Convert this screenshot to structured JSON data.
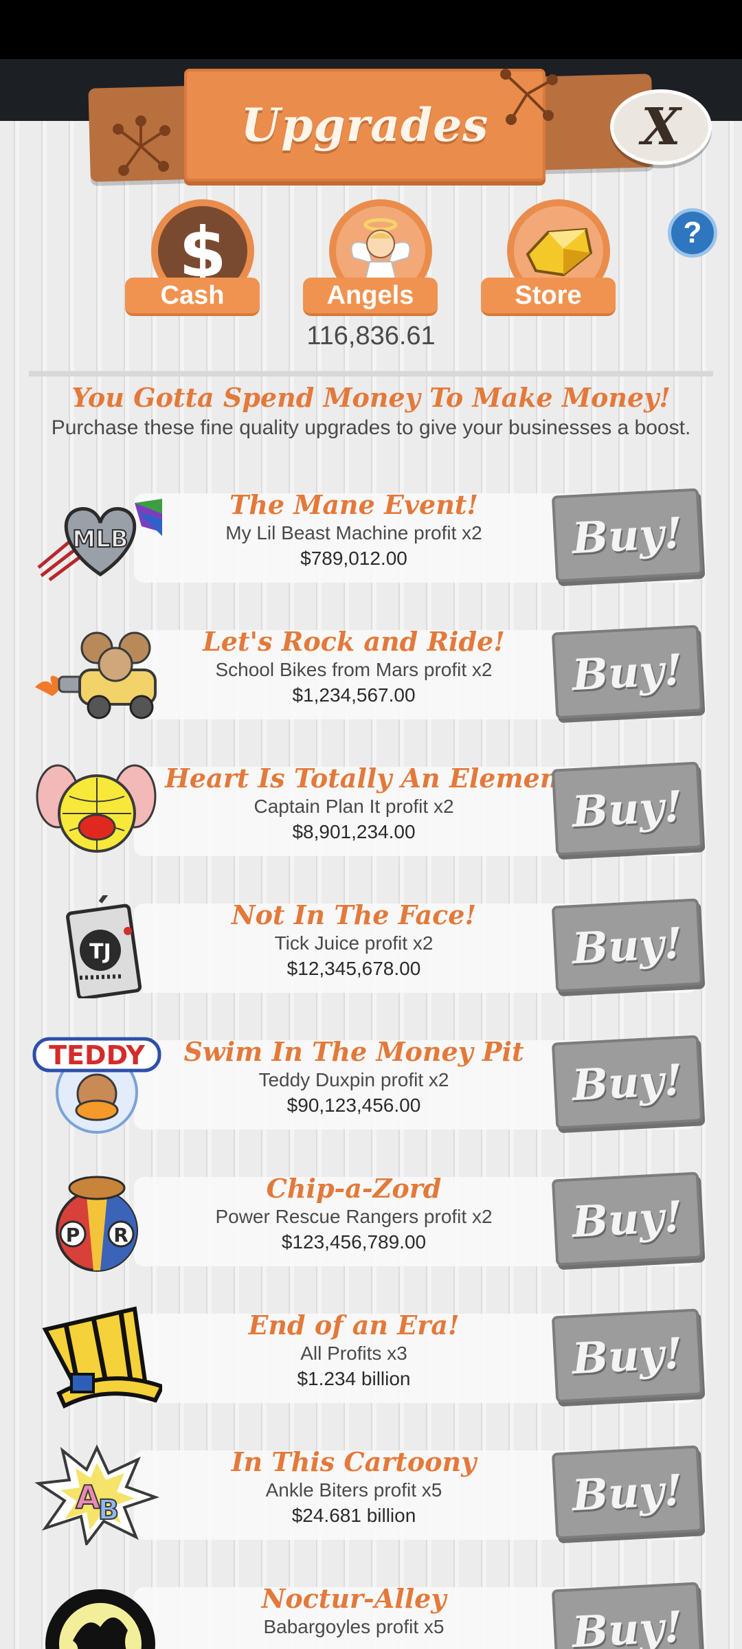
{
  "header": {
    "title": "Upgrades",
    "close_label": "X"
  },
  "tabs": [
    {
      "label": "Cash",
      "icon": "dollar-icon"
    },
    {
      "label": "Angels",
      "icon": "angel-icon"
    },
    {
      "label": "Store",
      "icon": "gold-icon"
    }
  ],
  "help_label": "?",
  "balance": "116,836.61",
  "headline": "You Gotta Spend Money To Make Money!",
  "subline": "Purchase these fine quality upgrades to give your businesses a boost.",
  "upgrades": [
    {
      "title": "The Mane Event!",
      "desc": "My Lil Beast Machine profit x2",
      "price": "$789,012.00",
      "buy_label": "Buy!",
      "icon": "mlb-heart-icon"
    },
    {
      "title": "Let's Rock and Ride!",
      "desc": "School Bikes from Mars profit x2",
      "price": "$1,234,567.00",
      "buy_label": "Buy!",
      "icon": "mouse-car-icon"
    },
    {
      "title": "Heart Is Totally An Element",
      "desc": "Captain Plan It profit x2",
      "price": "$8,901,234.00",
      "buy_label": "Buy!",
      "icon": "globe-ears-icon"
    },
    {
      "title": "Not In The Face!",
      "desc": "Tick Juice profit x2",
      "price": "$12,345,678.00",
      "buy_label": "Buy!",
      "icon": "juice-box-icon"
    },
    {
      "title": "Swim In The Money Pit",
      "desc": "Teddy Duxpin profit x2",
      "price": "$90,123,456.00",
      "buy_label": "Buy!",
      "icon": "teddy-icon"
    },
    {
      "title": "Chip-a-Zord",
      "desc": "Power Rescue Rangers profit x2",
      "price": "$123,456,789.00",
      "buy_label": "Buy!",
      "icon": "prr-ball-icon"
    },
    {
      "title": "End of an Era!",
      "desc": "All Profits x3",
      "price": "$1.234 billion",
      "buy_label": "Buy!",
      "icon": "top-hat-icon"
    },
    {
      "title": "In This Cartoony",
      "desc": "Ankle Biters profit x5",
      "price": "$24.681 billion",
      "buy_label": "Buy!",
      "icon": "ab-burst-icon"
    },
    {
      "title": "Noctur-Alley",
      "desc": "Babargoyles profit x5",
      "price": "",
      "buy_label": "Buy!",
      "icon": "gargoyle-icon"
    }
  ],
  "icon_text": {
    "mlb": "MLB",
    "teddy": "TEDDY",
    "tj": "TJ",
    "p": "P",
    "r": "R",
    "a": "A",
    "b": "B"
  },
  "colors": {
    "accent": "#ea8c4c",
    "title_orange": "#e3793a",
    "buy_gray": "#9c9c9c",
    "help_blue": "#2e76c0"
  }
}
